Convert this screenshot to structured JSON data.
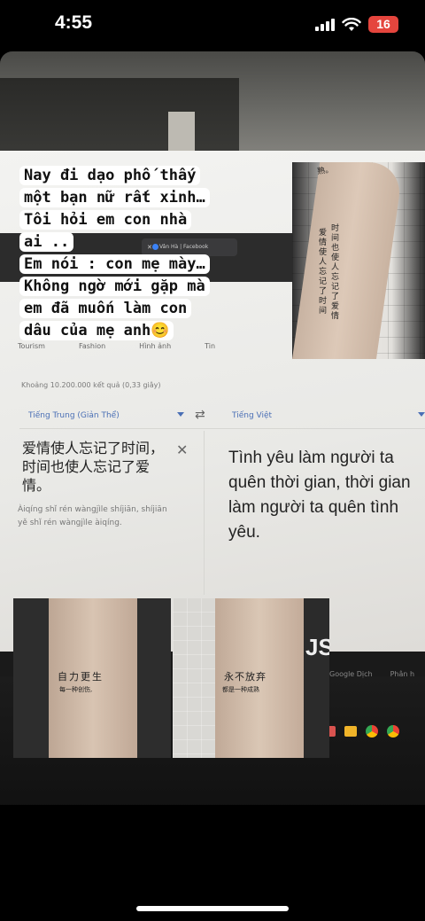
{
  "status_bar": {
    "time": "4:55",
    "battery": "16",
    "battery_color": "#e5453d"
  },
  "caption": {
    "lines": [
      "Nay đi dạo phố thấy",
      "một bạn nữ rất xinh…",
      "Tôi hỏi em con nhà",
      "ai ..",
      "Em nói : con mẹ mày…",
      "Không ngờ mới gặp mà",
      "em đã muốn làm con",
      "dâu của mẹ anh😊"
    ]
  },
  "browser": {
    "tab_label": "Vân Hà | Facebook",
    "search_tabs": [
      "Tourism",
      "Fashion",
      "Hình ảnh",
      "Tin"
    ],
    "result_count": "Khoảng 10.200.000 kết quả (0,33 giây)"
  },
  "translate": {
    "source_lang": "Tiếng Trung (Giản Thể)",
    "target_lang": "Tiếng Việt",
    "source_text": "爱情使人忘记了时间，时间也使人忘记了爱情。",
    "pinyin": "Àiqíng shǐ rén wàngjìle shíjiān, shíjiān yě shǐ rén wàngjìle àiqíng.",
    "target_text": "Tình yêu làm người ta quên thời gian, thời gian làm người ta quên tình yêu."
  },
  "taskbar": {
    "labels": [
      "Google Dịch",
      "Phân h"
    ]
  },
  "photos": {
    "top_arm_col1": "时间也使人忘记了爱情",
    "top_arm_col2": "爱情使人忘记了时间",
    "top_arm_top": "熟。",
    "left_arm_line1": "自力更生",
    "left_arm_line2": "每一种创伤,",
    "right_arm_line1": "永不放弃",
    "right_arm_line2": "都是一种成熟",
    "shirt_text": "JS"
  }
}
